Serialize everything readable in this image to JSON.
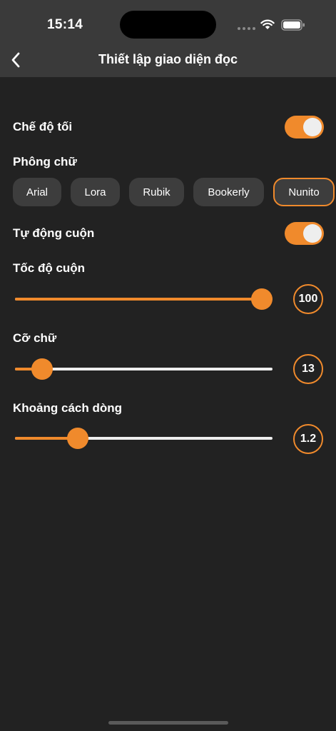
{
  "status_bar": {
    "time": "15:14",
    "icons": [
      "signal-dots-icon",
      "wifi-icon",
      "battery-icon"
    ]
  },
  "header": {
    "title": "Thiết lập giao diện đọc",
    "back_icon": "chevron-left-icon"
  },
  "settings": {
    "dark_mode": {
      "label": "Chế độ tối",
      "enabled": true
    },
    "font": {
      "label": "Phông chữ",
      "options": [
        "Arial",
        "Lora",
        "Rubik",
        "Bookerly",
        "Nunito"
      ],
      "selected": "Nunito"
    },
    "auto_scroll": {
      "label": "Tự động cuộn",
      "enabled": true
    },
    "scroll_speed": {
      "label": "Tốc độ cuộn",
      "value": "100",
      "level": 1.0
    },
    "font_size": {
      "label": "Cỡ chữ",
      "value": "13",
      "level": 0.07
    },
    "line_spacing": {
      "label": "Khoảng cách dòng",
      "value": "1.2",
      "level": 0.22
    }
  },
  "colors": {
    "accent": "#f08a2c",
    "background": "#222222",
    "header": "#3a3a3a",
    "chip": "#3d3d3d"
  }
}
